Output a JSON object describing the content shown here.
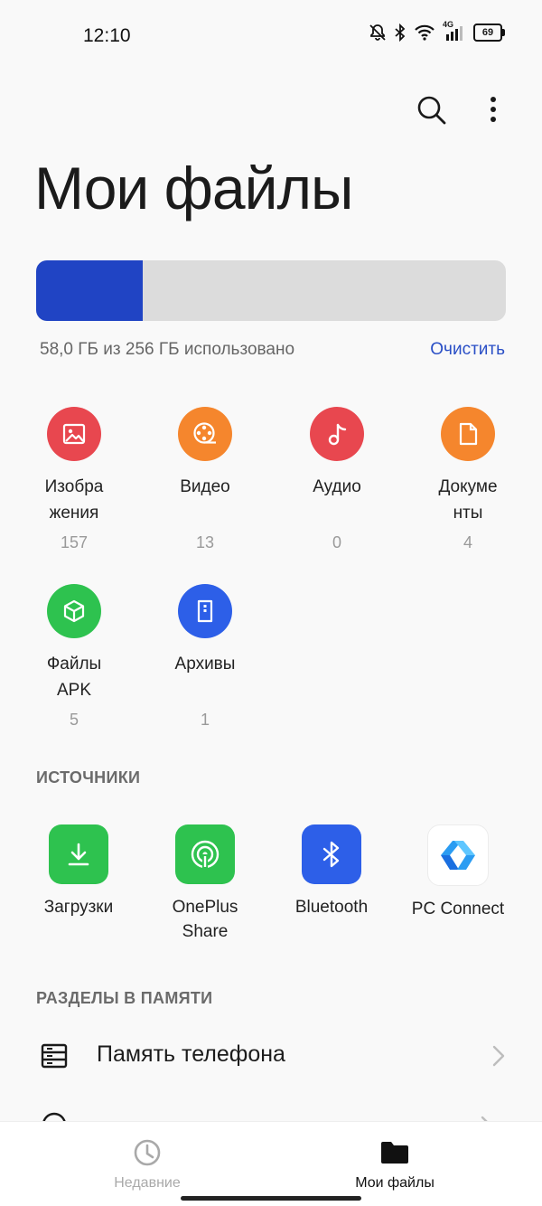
{
  "status_bar": {
    "time": "12:10",
    "network": "4G",
    "battery": "69"
  },
  "header": {
    "title": "Мои файлы"
  },
  "storage": {
    "used_fraction": 0.227,
    "summary": "58,0 ГБ из 256 ГБ использовано",
    "clean_label": "Очистить",
    "colors": {
      "used": "#2044c4",
      "free": "#dcdcdc"
    }
  },
  "categories": [
    {
      "label": "Изобра\nжения",
      "count": "157",
      "icon": "image-icon",
      "color": "#e8474f"
    },
    {
      "label": "Видео",
      "count": "13",
      "icon": "video-reel-icon",
      "color": "#f5862d"
    },
    {
      "label": "Аудио",
      "count": "0",
      "icon": "music-note-icon",
      "color": "#e8474f"
    },
    {
      "label": "Докуме\nнты",
      "count": "4",
      "icon": "document-icon",
      "color": "#f5862d"
    },
    {
      "label": "Файлы\nAPK",
      "count": "5",
      "icon": "apk-cube-icon",
      "color": "#2ec24f"
    },
    {
      "label": "Архивы",
      "count": "1",
      "icon": "archive-icon",
      "color": "#2d5fe8"
    }
  ],
  "sources": {
    "title": "ИСТОЧНИКИ",
    "items": [
      {
        "label": "Загрузки",
        "icon": "download-icon",
        "color": "#2ec24f"
      },
      {
        "label": "OnePlus\nShare",
        "icon": "share-signal-icon",
        "color": "#2ec24f"
      },
      {
        "label": "Bluetooth",
        "icon": "bluetooth-icon",
        "color": "#2d5fe8"
      },
      {
        "label": "PC Connect",
        "icon": "pc-connect-icon",
        "color": "#ffffff"
      }
    ]
  },
  "memory_sections": {
    "title": "РАЗДЕЛЫ В ПАМЯТИ",
    "items": [
      {
        "label": "Память телефона"
      }
    ]
  },
  "bottom_nav": {
    "recent": "Недавние",
    "my_files": "Мои файлы"
  }
}
